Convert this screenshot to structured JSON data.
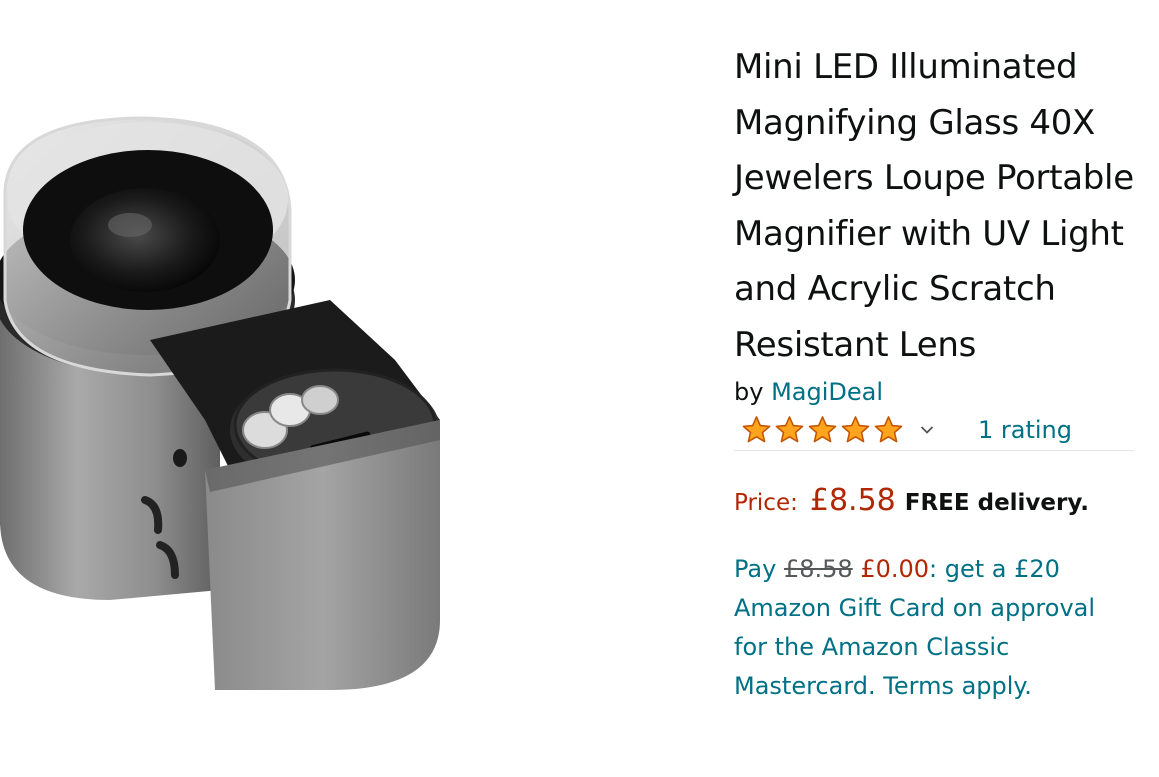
{
  "product": {
    "title": "Mini LED Illuminated Magnifying Glass 40X Jewelers Loupe Portable Magnifier with UV Light and Acrylic Scratch Resistant Lens",
    "by_label": "by",
    "brand": "MagiDeal",
    "image_alt": "Mini LED Illuminated Magnifying Glass jewelers loupe product photo"
  },
  "rating": {
    "stars": 5,
    "star_icon": "star-icon",
    "chevron_icon": "chevron-down-icon",
    "count_label": "1 rating"
  },
  "price": {
    "label": "Price:",
    "value": "£8.58",
    "delivery": "FREE delivery."
  },
  "promo": {
    "pay_label": "Pay",
    "old_price": "£8.58",
    "new_price": "£0.00",
    "text": ": get a £20 Amazon Gift Card on approval for the Amazon Classic Mastercard. Terms apply."
  },
  "colors": {
    "link": "#007185",
    "price": "#b12704",
    "star": "#ffa41c",
    "text": "#0f1111"
  }
}
